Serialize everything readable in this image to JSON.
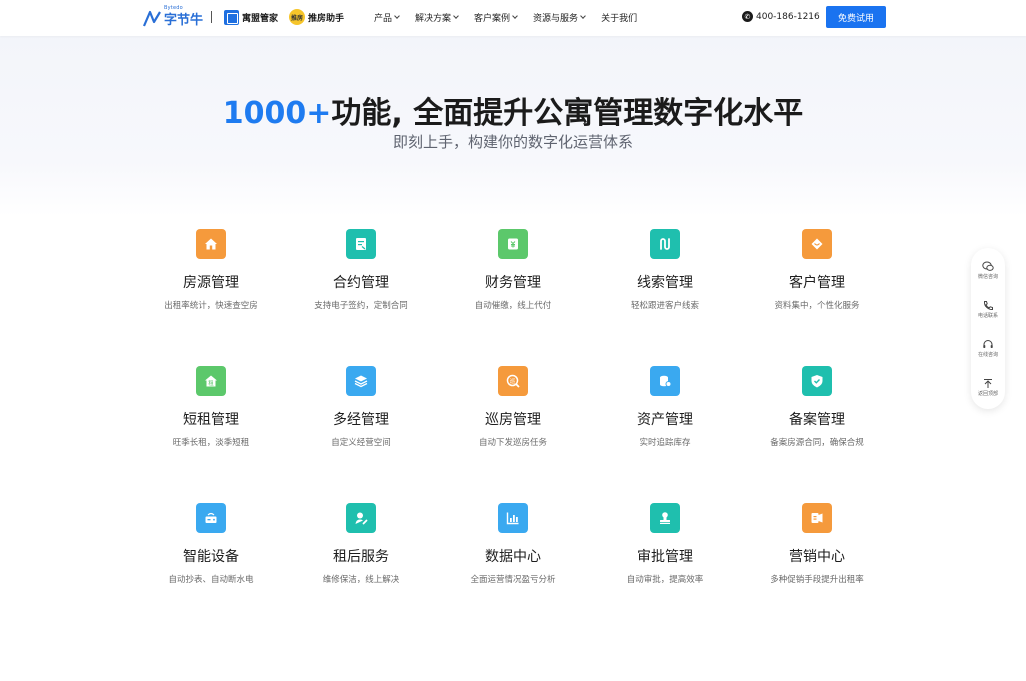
{
  "header": {
    "logo_sub": "Bytedo",
    "logo_text": "字节牛",
    "brand2_text": "寓盟管家",
    "brand3_badge": "推房",
    "brand3_text": "推房助手",
    "nav": [
      {
        "label": "产品",
        "dropdown": true
      },
      {
        "label": "解决方案",
        "dropdown": true
      },
      {
        "label": "客户案例",
        "dropdown": true
      },
      {
        "label": "资源与服务",
        "dropdown": true
      },
      {
        "label": "关于我们",
        "dropdown": false
      }
    ],
    "phone": "400-186-1216",
    "trial_button": "免费试用"
  },
  "hero": {
    "title_num": "1000+",
    "title_rest": "功能, 全面提升公寓管理数字化水平",
    "subtitle": "即刻上手，构建你的数字化运营体系"
  },
  "features": [
    {
      "title": "房源管理",
      "desc": "出租率统计，快速查空房",
      "icon": "house-icon",
      "color": "#f59a3c"
    },
    {
      "title": "合约管理",
      "desc": "支持电子签约，定制合同",
      "icon": "contract-icon",
      "color": "#1fbfae"
    },
    {
      "title": "财务管理",
      "desc": "自动催缴，线上代付",
      "icon": "finance-icon",
      "color": "#5cc86b"
    },
    {
      "title": "线索管理",
      "desc": "轻松跟进客户线索",
      "icon": "lead-icon",
      "color": "#1fbfae"
    },
    {
      "title": "客户管理",
      "desc": "资料集中，个性化服务",
      "icon": "customer-icon",
      "color": "#f59a3c"
    },
    {
      "title": "短租管理",
      "desc": "旺季长租，淡季短租",
      "icon": "short-rent-icon",
      "color": "#5cc86b"
    },
    {
      "title": "多经管理",
      "desc": "自定义经营空间",
      "icon": "layers-icon",
      "color": "#3aa9f0"
    },
    {
      "title": "巡房管理",
      "desc": "自动下发巡房任务",
      "icon": "patrol-icon",
      "color": "#f59a3c"
    },
    {
      "title": "资产管理",
      "desc": "实时追踪库存",
      "icon": "asset-icon",
      "color": "#3aa9f0"
    },
    {
      "title": "备案管理",
      "desc": "备案房源合同，确保合规",
      "icon": "shield-icon",
      "color": "#1fbfae"
    },
    {
      "title": "智能设备",
      "desc": "自动抄表、自动断水电",
      "icon": "device-icon",
      "color": "#3aa9f0"
    },
    {
      "title": "租后服务",
      "desc": "维修保洁，线上解决",
      "icon": "service-icon",
      "color": "#1fbfae"
    },
    {
      "title": "数据中心",
      "desc": "全面运营情况盈亏分析",
      "icon": "chart-icon",
      "color": "#3aa9f0"
    },
    {
      "title": "审批管理",
      "desc": "自动审批，提高效率",
      "icon": "stamp-icon",
      "color": "#1fbfae"
    },
    {
      "title": "营销中心",
      "desc": "多种促销手段提升出租率",
      "icon": "marketing-icon",
      "color": "#f59a3c"
    }
  ],
  "sidebar": [
    {
      "label": "微信咨询",
      "icon": "wechat-icon"
    },
    {
      "label": "电话联系",
      "icon": "phone-icon"
    },
    {
      "label": "在线咨询",
      "icon": "headset-icon"
    },
    {
      "label": "返回顶部",
      "icon": "back-to-top-icon"
    }
  ]
}
